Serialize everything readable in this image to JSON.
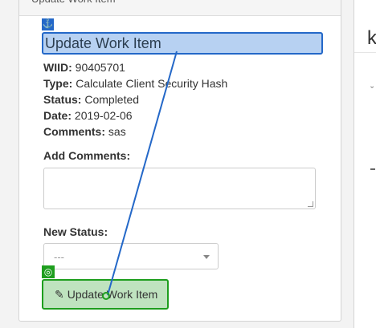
{
  "panel": {
    "heading": "Update Work Item"
  },
  "form": {
    "title": "Update Work Item",
    "wiid_label": "WIID:",
    "wiid_value": "90405701",
    "type_label": "Type:",
    "type_value": "Calculate Client Security Hash",
    "status_label": "Status:",
    "status_value": "Completed",
    "date_label": "Date:",
    "date_value": "2019-02-06",
    "comments_label": "Comments:",
    "comments_value": "sas",
    "add_comments_label": "Add Comments:",
    "add_comments_value": "",
    "new_status_label": "New Status:",
    "new_status_selected": "---",
    "submit_label": "Update Work Item"
  },
  "right_edge": {
    "glyph": "k"
  },
  "icons": {
    "anchor": "anchor-icon",
    "target": "target-icon",
    "pencil": "pencil-icon",
    "caret": "caret-down-icon"
  },
  "colors": {
    "highlight_blue": "#2468c8",
    "highlight_green": "#1e9e1e"
  }
}
